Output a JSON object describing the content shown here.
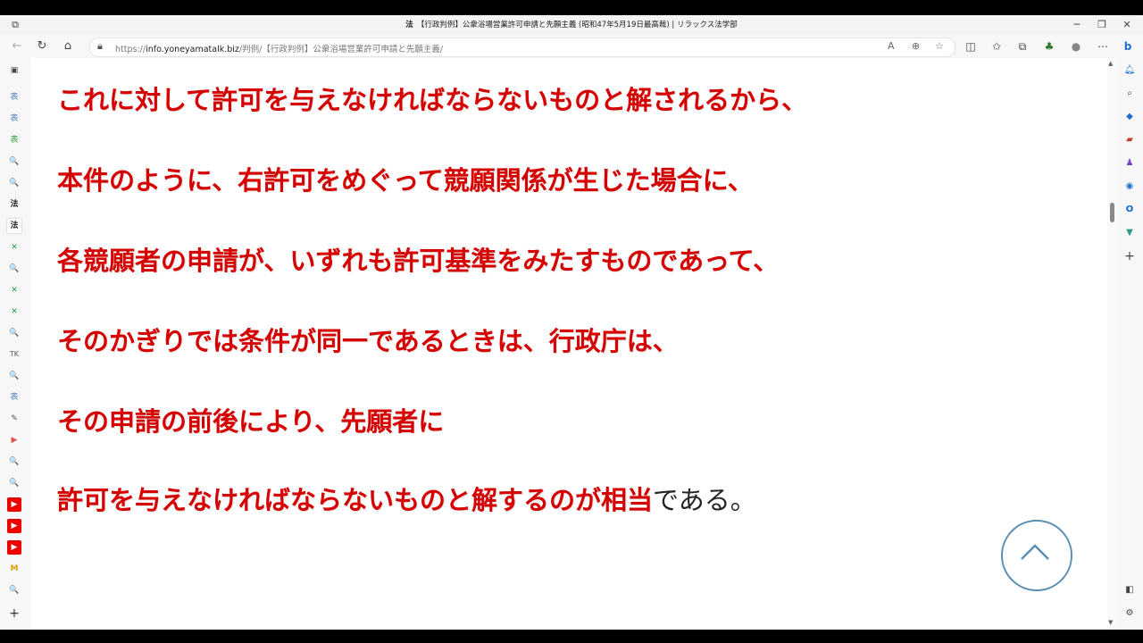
{
  "window": {
    "title": "【行政判例】公衆浴場営業許可申請と先願主義 (昭和47年5月19日最高裁) | リラックス法学部",
    "favicon_text": "法"
  },
  "address_bar": {
    "url_prefix": "https://",
    "url_host": "info.yoneyamatalk.biz",
    "url_path": "/判例/【行政判例】公衆浴場営業許可申請と先願主義/"
  },
  "article": {
    "lines": [
      "これに対して許可を与えなければならないものと解されるから、",
      "本件のように、右許可をめぐって競願関係が生じた場合に、",
      "各競願者の申請が、いずれも許可基準をみたすものであって、",
      "そのかぎりでは条件が同一であるときは、行政庁は、",
      "その申請の前後により、先願者に",
      "許可を与えなければならないものと解するのが相当"
    ],
    "last_line_tail": "である。"
  },
  "icons": {
    "tab_actions": "tab-actions-icon",
    "minimize": "minimize-icon",
    "restore": "restore-icon",
    "close": "close-icon",
    "back": "back-arrow-icon",
    "refresh": "refresh-icon",
    "home": "home-icon",
    "scroll_to_top": "chevron-up-icon"
  },
  "left_sidebar_tabs": [
    "表",
    "表",
    "表",
    "🔍",
    "🔍",
    "法",
    "法",
    "✕",
    "🔍",
    "✕",
    "✕",
    "🔍",
    "TK",
    "🔍",
    "表",
    "✎",
    "▶",
    "🔍",
    "🔍",
    "▶",
    "▶",
    "▶",
    "M",
    "🔍"
  ],
  "colors": {
    "article_red": "#d60000",
    "accent_blue": "#5a8fb4"
  }
}
